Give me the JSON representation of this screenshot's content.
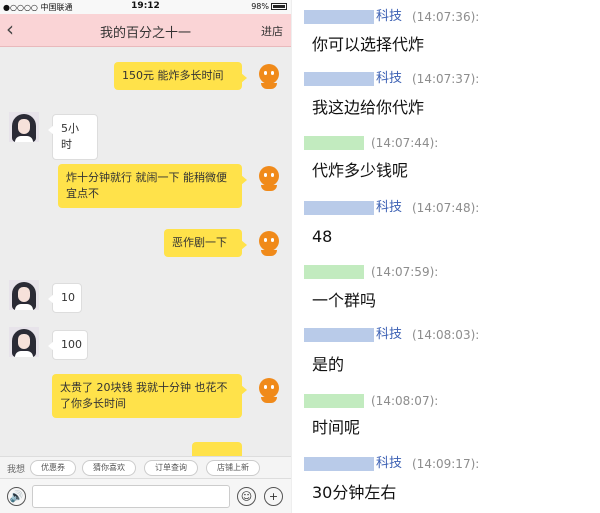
{
  "phone": {
    "status": {
      "carrier": "●○○○○ 中国联通",
      "time": "19:12",
      "battery": "98%"
    },
    "nav": {
      "back": "‹",
      "title": "我的百分之十一",
      "store": "进店"
    },
    "messages": [
      {
        "side": "right",
        "text": "150元 能炸多长时间"
      },
      {
        "side": "left",
        "text": "5小时"
      },
      {
        "side": "right",
        "text": "炸十分钟就行 就闹一下 能稍微便宜点不"
      },
      {
        "side": "right",
        "text": "恶作剧一下"
      },
      {
        "side": "left",
        "text": "10"
      },
      {
        "side": "left",
        "text": "100"
      },
      {
        "side": "right",
        "text": "太贵了 20块钱 我就十分钟 也花不了你多长时间"
      }
    ],
    "quickbar": {
      "label": "我想",
      "chips": [
        "优惠券",
        "猜你喜欢",
        "订单查询",
        "店铺上新"
      ]
    },
    "inputbar": {
      "voice": "🔊",
      "emoji": "☺",
      "plus": "+"
    }
  },
  "log": {
    "entries": [
      {
        "sender": "科技",
        "time": "(14:07:36):",
        "text": "你可以选择代炸",
        "color": "blue"
      },
      {
        "sender": "科技",
        "time": "(14:07:37):",
        "text": "我这边给你代炸",
        "color": "blue"
      },
      {
        "sender": "",
        "time": "(14:07:44):",
        "text": "代炸多少钱呢",
        "color": "green"
      },
      {
        "sender": "科技",
        "time": "(14:07:48):",
        "text": "48",
        "color": "blue"
      },
      {
        "sender": "",
        "time": "(14:07:59):",
        "text": "一个群吗",
        "color": "green"
      },
      {
        "sender": "科技",
        "time": "(14:08:03):",
        "text": "是的",
        "color": "blue"
      },
      {
        "sender": "",
        "time": "(14:08:07):",
        "text": "时间呢",
        "color": "green"
      },
      {
        "sender": "科技",
        "time": "(14:09:17):",
        "text": "30分钟左右",
        "color": "blue"
      }
    ]
  },
  "colors": {
    "nav_pink": "#fad4d6",
    "bubble_yellow": "#ffe24a",
    "sender_blue": "#3a5fb3"
  }
}
